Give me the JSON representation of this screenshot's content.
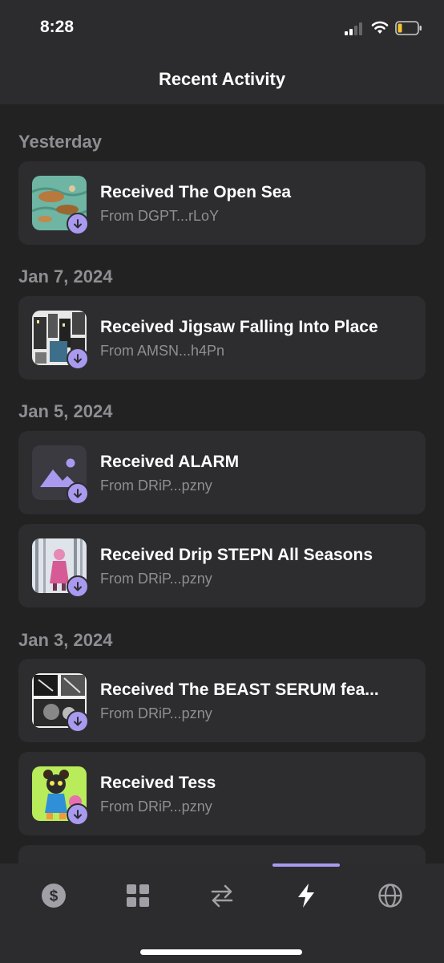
{
  "status_bar": {
    "time": "8:28"
  },
  "header": {
    "title": "Recent Activity"
  },
  "groups": [
    {
      "date": "Yesterday",
      "items": [
        {
          "title": "Received The Open Sea",
          "from": "From DGPT...rLoY",
          "thumb": "open-sea-art"
        }
      ]
    },
    {
      "date": "Jan 7, 2024",
      "items": [
        {
          "title": "Received Jigsaw Falling Into Place",
          "from": "From AMSN...h4Pn",
          "thumb": "jigsaw-city-art"
        }
      ]
    },
    {
      "date": "Jan 5, 2024",
      "items": [
        {
          "title": "Received ALARM",
          "from": "From DRiP...pzny",
          "thumb": "image-placeholder-icon"
        },
        {
          "title": "Received Drip STEPN All Seasons",
          "from": "From DRiP...pzny",
          "thumb": "stepn-forest-art"
        }
      ]
    },
    {
      "date": "Jan 3, 2024",
      "items": [
        {
          "title": "Received The BEAST SERUM fea...",
          "from": "From DRiP...pzny",
          "thumb": "beast-serum-comic-art"
        },
        {
          "title": "Received Tess",
          "from": "From DRiP...pzny",
          "thumb": "tess-character-art"
        }
      ]
    }
  ],
  "tabbar": {
    "tabs": [
      {
        "name": "wallet",
        "icon": "dollar-icon",
        "active": false
      },
      {
        "name": "collectibles",
        "icon": "grid-icon",
        "active": false
      },
      {
        "name": "swap",
        "icon": "swap-arrows-icon",
        "active": false
      },
      {
        "name": "activity",
        "icon": "lightning-icon",
        "active": true
      },
      {
        "name": "explore",
        "icon": "globe-icon",
        "active": false
      }
    ]
  },
  "colors": {
    "accent": "#a99af0",
    "background": "#222222",
    "card": "#2d2d30",
    "secondary_text": "#8e8e93"
  }
}
